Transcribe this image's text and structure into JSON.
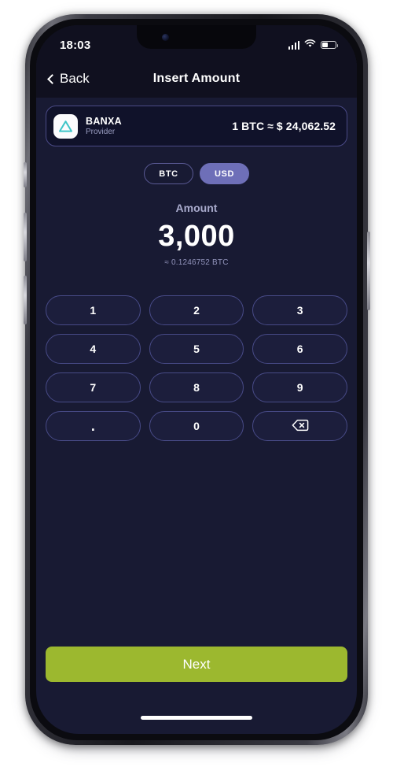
{
  "status_bar": {
    "time": "18:03",
    "signal_icon": "cellular-signal-icon",
    "wifi_icon": "wifi-icon",
    "battery_icon": "battery-icon",
    "battery_level_percent": 38
  },
  "navbar": {
    "back_label": "Back",
    "back_icon": "chevron-left-icon",
    "title": "Insert Amount"
  },
  "provider_card": {
    "logo_icon": "banxa-triangle-logo-icon",
    "name": "BANXA",
    "role": "Provider",
    "rate": "1 BTC ≈ $ 24,062.52"
  },
  "currency_toggle": {
    "options": [
      {
        "label": "BTC",
        "selected": false
      },
      {
        "label": "USD",
        "selected": true
      }
    ],
    "selected_color": "#6e6fb8"
  },
  "amount": {
    "label": "Amount",
    "value": "3,000",
    "converted": "≈ 0.1246752 BTC"
  },
  "keypad": {
    "keys": [
      {
        "label": "1",
        "name": "key-1"
      },
      {
        "label": "2",
        "name": "key-2"
      },
      {
        "label": "3",
        "name": "key-3"
      },
      {
        "label": "4",
        "name": "key-4"
      },
      {
        "label": "5",
        "name": "key-5"
      },
      {
        "label": "6",
        "name": "key-6"
      },
      {
        "label": "7",
        "name": "key-7"
      },
      {
        "label": "8",
        "name": "key-8"
      },
      {
        "label": "9",
        "name": "key-9"
      },
      {
        "label": ".",
        "name": "key-decimal"
      },
      {
        "label": "0",
        "name": "key-0"
      },
      {
        "label": "",
        "name": "key-backspace",
        "icon": "backspace-icon"
      }
    ]
  },
  "footer": {
    "next_label": "Next",
    "next_color": "#9cb82f"
  },
  "theme": {
    "screen_background": "#181a33",
    "header_background": "#10101f",
    "card_background": "#10122a",
    "border_purple": "#4a4a86",
    "key_background": "#1c1e3c",
    "accent_teal": "#3ec5c8",
    "muted_text": "#9b9ec2"
  }
}
